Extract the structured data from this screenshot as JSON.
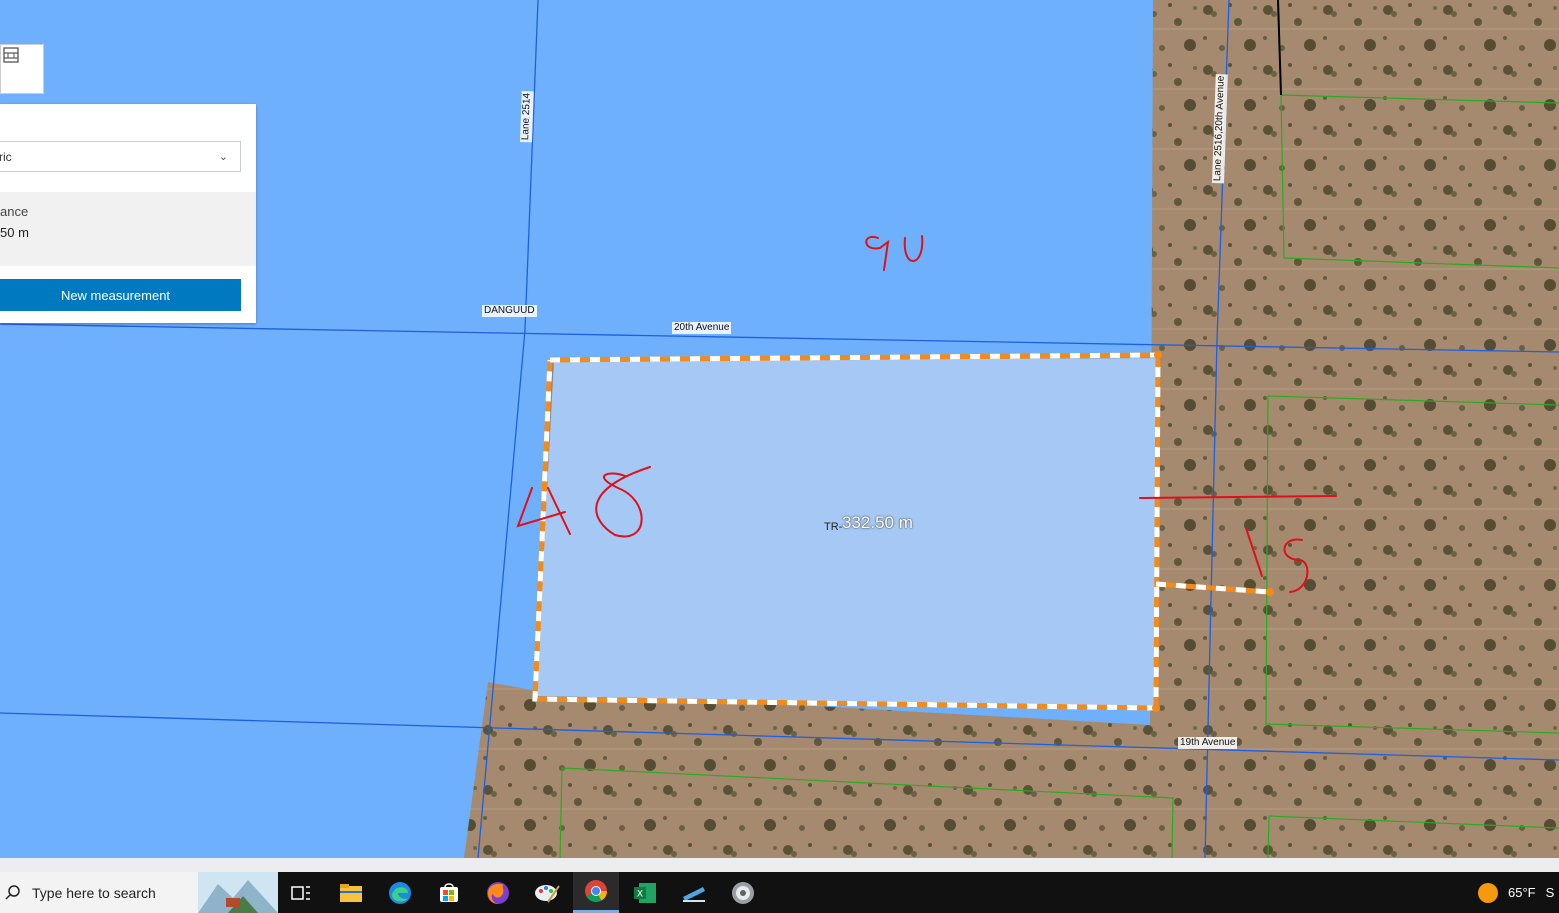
{
  "map": {
    "roads": {
      "twentieth_avenue": "20th Avenue",
      "nineteenth_avenue": "19th Avenue",
      "lane_2514": "Lane 2514",
      "lane_2516": "Lane 2516,20th Avenue",
      "area_name": "DANGUUD"
    },
    "measurement_value": "332.50 m",
    "parcel_label": "TR-",
    "handwritten_notes": [
      "90",
      "48",
      "15"
    ],
    "colors": {
      "zone_blue": "#6fb0fc",
      "parcel_fill": "#a5c8f4",
      "road_line": "#1d5fe0",
      "parcel_line": "#2aab1f",
      "measure_orange": "#f28a1c",
      "ink_red": "#e0101b"
    }
  },
  "measure_panel": {
    "tool_icon": "measure-tool-icon",
    "unit_value": "ric",
    "result_label": "ance",
    "result_value": "50 m",
    "new_measurement_label": "New measurement"
  },
  "taskbar": {
    "search_placeholder": "Type here to search",
    "apps": [
      "task-view-icon",
      "file-explorer-icon",
      "edge-icon",
      "store-icon",
      "firefox-icon",
      "paint-icon",
      "chrome-icon",
      "excel-icon",
      "snipping-tool-icon",
      "pro-app-icon"
    ],
    "temperature": "65°F",
    "weather_extra": "S"
  }
}
